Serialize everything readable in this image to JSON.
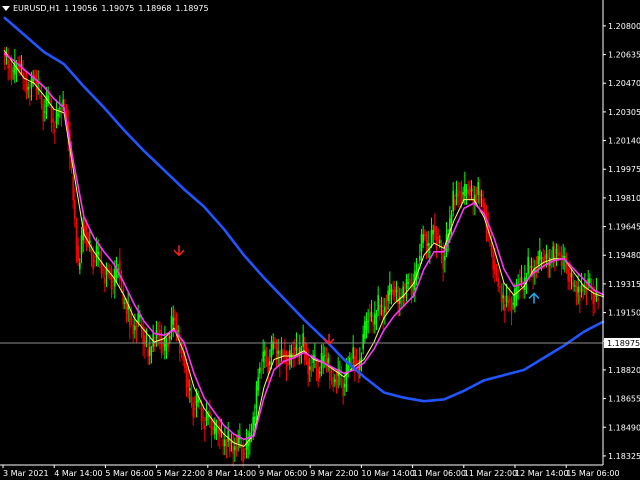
{
  "header": {
    "symbol": "EURUSD,H1",
    "open": "1.19056",
    "high": "1.19075",
    "low": "1.18968",
    "close": "1.18975"
  },
  "colors": {
    "background": "#000000",
    "bull": "#00ff00",
    "bear": "#ff0000",
    "ma_fast": "#ffff66",
    "ma_mid": "#ff33ff",
    "ma_slow": "#2255ff",
    "bid_line": "#8c8c8c",
    "arrow_down": "#ff2020",
    "arrow_up": "#22aaee"
  },
  "icons": {
    "menu": "triangle-down-icon",
    "sell_signal": "arrow-down-icon",
    "buy_signal": "arrow-up-icon"
  },
  "current_price": "1.18975",
  "chart_data": {
    "type": "line",
    "title": "",
    "xlabel": "",
    "ylabel": "",
    "ylim": [
      1.1829,
      1.2088
    ],
    "y_ticks": [
      "1.20800",
      "1.20635",
      "1.20470",
      "1.20305",
      "1.20140",
      "1.19975",
      "1.19810",
      "1.19645",
      "1.19480",
      "1.19315",
      "1.19150",
      "1.18985",
      "1.18820",
      "1.18655",
      "1.18490",
      "1.18325"
    ],
    "x_ticks": [
      "3 Mar 2021",
      "4 Mar 14:00",
      "5 Mar 06:00",
      "5 Mar 22:00",
      "8 Mar 14:00",
      "9 Mar 06:00",
      "9 Mar 22:00",
      "10 Mar 14:00",
      "11 Mar 06:00",
      "11 Mar 22:00",
      "12 Mar 14:00",
      "15 Mar 06:00"
    ],
    "series": [
      {
        "role": "price",
        "x": [
          0,
          5,
          10,
          15,
          20,
          25,
          30,
          35,
          40,
          45,
          50,
          55,
          60,
          65,
          70,
          75,
          80,
          85,
          90,
          95,
          100,
          105,
          110,
          115,
          120,
          125,
          130,
          135,
          140,
          145,
          150,
          155,
          160,
          165,
          170,
          175,
          180,
          185,
          190,
          195,
          200,
          205,
          210,
          215,
          220,
          225,
          230,
          235,
          240,
          245,
          250,
          255,
          260,
          265,
          270,
          275,
          280,
          285,
          290,
          295,
          300,
          305,
          310,
          315,
          320,
          325,
          330,
          335,
          340,
          345,
          350,
          355,
          360,
          365,
          370,
          375,
          380,
          385,
          390,
          395,
          400,
          405,
          410,
          415,
          420,
          425,
          430,
          435,
          440,
          445,
          450,
          455,
          460,
          465,
          470,
          475,
          480,
          485,
          490,
          495,
          500,
          505,
          510,
          515,
          520,
          525,
          530,
          535,
          540,
          545,
          550,
          555,
          560,
          565,
          570,
          575,
          580,
          585,
          590,
          595
        ],
        "y": [
          1.2065,
          1.2058,
          1.2052,
          1.206,
          1.205,
          1.204,
          1.2052,
          1.2045,
          1.203,
          1.204,
          1.202,
          1.2032,
          1.2035,
          1.202,
          1.198,
          1.194,
          1.1965,
          1.1955,
          1.1945,
          1.195,
          1.1935,
          1.194,
          1.193,
          1.1945,
          1.192,
          1.1915,
          1.1905,
          1.1912,
          1.1902,
          1.189,
          1.1898,
          1.1905,
          1.1893,
          1.19,
          1.1912,
          1.19,
          1.189,
          1.187,
          1.186,
          1.1865,
          1.185,
          1.1858,
          1.1845,
          1.185,
          1.1838,
          1.1842,
          1.1836,
          1.1842,
          1.1834,
          1.184,
          1.185,
          1.188,
          1.189,
          1.1885,
          1.1898,
          1.1888,
          1.1893,
          1.1885,
          1.1895,
          1.189,
          1.1898,
          1.1882,
          1.1888,
          1.188,
          1.189,
          1.1884,
          1.1875,
          1.188,
          1.1872,
          1.1885,
          1.189,
          1.1882,
          1.19,
          1.1915,
          1.1908,
          1.192,
          1.1915,
          1.1925,
          1.193,
          1.192,
          1.1925,
          1.1935,
          1.1928,
          1.1945,
          1.196,
          1.195,
          1.1965,
          1.1955,
          1.1945,
          1.196,
          1.198,
          1.1985,
          1.1982,
          1.1988,
          1.1978,
          1.1985,
          1.1978,
          1.196,
          1.1945,
          1.193,
          1.192,
          1.1923,
          1.1918,
          1.1935,
          1.1928,
          1.1942,
          1.1938,
          1.1945,
          1.1948,
          1.1942,
          1.1948,
          1.195,
          1.1945,
          1.1938,
          1.193,
          1.1925,
          1.193,
          1.1932,
          1.1925,
          1.1922
        ]
      },
      {
        "role": "ma_fast",
        "x": [
          0,
          10,
          20,
          30,
          40,
          50,
          60,
          70,
          80,
          90,
          100,
          110,
          120,
          130,
          140,
          150,
          160,
          170,
          180,
          190,
          200,
          210,
          220,
          230,
          240,
          250,
          260,
          270,
          280,
          290,
          300,
          310,
          320,
          330,
          340,
          350,
          360,
          370,
          380,
          390,
          400,
          410,
          420,
          430,
          440,
          450,
          460,
          470,
          480,
          490,
          500,
          510,
          520,
          530,
          540,
          550,
          560,
          570,
          580,
          590,
          600
        ],
        "y": [
          1.2066,
          1.2058,
          1.205,
          1.2047,
          1.204,
          1.2032,
          1.203,
          1.1995,
          1.196,
          1.195,
          1.1942,
          1.1935,
          1.1925,
          1.1912,
          1.1905,
          1.1898,
          1.19,
          1.1906,
          1.1892,
          1.1872,
          1.186,
          1.1852,
          1.1845,
          1.184,
          1.1838,
          1.1845,
          1.1872,
          1.1888,
          1.189,
          1.189,
          1.1893,
          1.1888,
          1.1886,
          1.1882,
          1.1878,
          1.1884,
          1.1888,
          1.1898,
          1.1912,
          1.192,
          1.1925,
          1.1932,
          1.1948,
          1.1955,
          1.1952,
          1.1968,
          1.198,
          1.198,
          1.197,
          1.1952,
          1.1932,
          1.1925,
          1.193,
          1.194,
          1.1944,
          1.1946,
          1.1946,
          1.1938,
          1.193,
          1.1926,
          1.1924
        ]
      },
      {
        "role": "ma_mid",
        "x": [
          0,
          10,
          20,
          30,
          40,
          50,
          60,
          70,
          80,
          90,
          100,
          110,
          120,
          130,
          140,
          150,
          160,
          170,
          180,
          190,
          200,
          210,
          220,
          230,
          240,
          250,
          260,
          270,
          280,
          290,
          300,
          310,
          320,
          330,
          340,
          350,
          360,
          370,
          380,
          390,
          400,
          410,
          420,
          430,
          440,
          450,
          460,
          470,
          480,
          490,
          500,
          510,
          520,
          530,
          540,
          550,
          560,
          570,
          580,
          590,
          600
        ],
        "y": [
          1.2064,
          1.206,
          1.2055,
          1.205,
          1.2045,
          1.2038,
          1.2033,
          1.2,
          1.197,
          1.1958,
          1.195,
          1.1943,
          1.1932,
          1.192,
          1.191,
          1.1903,
          1.1902,
          1.1905,
          1.1898,
          1.188,
          1.1866,
          1.1858,
          1.185,
          1.1845,
          1.1842,
          1.1844,
          1.1866,
          1.1882,
          1.1887,
          1.1889,
          1.1892,
          1.1889,
          1.1886,
          1.1883,
          1.188,
          1.1882,
          1.1886,
          1.1894,
          1.1905,
          1.1913,
          1.1919,
          1.1925,
          1.194,
          1.195,
          1.195,
          1.1962,
          1.1975,
          1.1978,
          1.1972,
          1.1958,
          1.194,
          1.193,
          1.1932,
          1.1938,
          1.1942,
          1.1945,
          1.1946,
          1.194,
          1.1934,
          1.1928,
          1.1925
        ]
      },
      {
        "role": "ma_slow",
        "x": [
          0,
          20,
          40,
          60,
          80,
          100,
          120,
          140,
          160,
          180,
          200,
          220,
          240,
          260,
          280,
          300,
          320,
          340,
          360,
          380,
          400,
          420,
          440,
          460,
          480,
          500,
          520,
          540,
          560,
          580,
          600
        ],
        "y": [
          1.2085,
          1.2075,
          1.2065,
          1.2058,
          1.2045,
          1.2033,
          1.202,
          1.2008,
          1.1997,
          1.1986,
          1.1976,
          1.1963,
          1.1948,
          1.1935,
          1.1923,
          1.1911,
          1.19,
          1.1888,
          1.1878,
          1.1869,
          1.1866,
          1.1864,
          1.1865,
          1.187,
          1.1876,
          1.1879,
          1.1882,
          1.1889,
          1.1896,
          1.1904,
          1.191
        ]
      }
    ],
    "signals": [
      {
        "type": "down",
        "x": 175,
        "y": 1.1948
      },
      {
        "type": "down",
        "x": 325,
        "y": 1.1897
      },
      {
        "type": "up",
        "x": 530,
        "y": 1.1926
      }
    ]
  }
}
